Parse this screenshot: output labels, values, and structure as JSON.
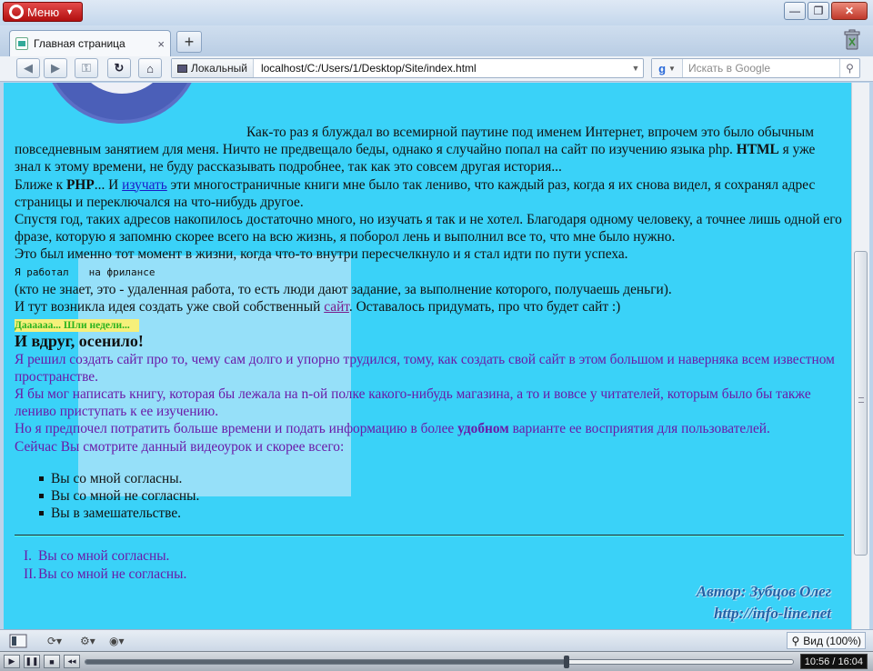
{
  "window": {
    "menu_label": "Меню",
    "controls": [
      "—",
      "❐",
      "✕"
    ]
  },
  "tab": {
    "title": "Главная страница",
    "close": "×",
    "new_tab": "+"
  },
  "navbar": {
    "back": "◀",
    "forward": "▶",
    "reload": "↻",
    "home": "⌂",
    "key": "⚿",
    "site_label": "Локальный",
    "url": "localhost/C:/Users/1/Desktop/Site/index.html",
    "search_placeholder": "Искать в Google",
    "search_engine": "g"
  },
  "page": {
    "para1": "Как-то раз я блуждал во всемирной паутине под именем Интернет, впрочем это было обычным повседневным занятием для меня. Ничто не предвещало беды, однако я случайно попал на сайт по изучению языка php.",
    "html_bold": "HTML",
    "para1_tail": "я уже знал к этому времени, не буду рассказывать подробнее, так как это совсем другая история...",
    "line2_a": "Ближе к",
    "php_bold": "PHP",
    "line2_b": "... И",
    "link_izuchat": "изучать",
    "line2_c": "эти многостраничные книги мне было так лениво, что каждый раз, когда я их снова видел, я сохранял адрес страницы и переключался на что-нибудь другое.",
    "line3": "Спустя год, таких адресов накопилось достаточно много, но изучать я так и не хотел. Благодаря одному человеку, а точнее лишь одной его фразе, которую я запомню скорее всего на всю жизнь, я поборол лень и выполнил все то, что мне было нужно.",
    "line4": "Это был именно тот момент в жизни, когда что-то внутри пересчелкнуло и я стал идти по пути успеха.",
    "pre_a": "Я работал",
    "pre_b": "на фрилансе",
    "line5": "(кто не знает, это - удаленная работа, то есть люди дают задание, за выполнение которого, получаешь деньги).",
    "line6_a": "И тут возникла идея создать уже свой собственный",
    "link_sait": "сайт",
    "line6_b": ". Оставалось придумать, про что будет сайт :)",
    "highlight": "Даааааа... Шли недели...",
    "heading": "И вдруг, осенило!",
    "purple1": "Я решил создать сайт про то, чему сам долго и упорно трудился, тому, как создать свой сайт в этом большом и наверняка всем известном пространстве.",
    "purple2": "Я бы мог написать книгу, которая бы лежала на n-ой полке какого-нибудь магазина, а то и вовсе у читателей, которым было бы также лениво приступать к ее изучению.",
    "purple3_a": "Но я предпочел потратить больше времени и подать информацию в более",
    "purple3_bold": "удобном",
    "purple3_b": "варианте ее восприятия для пользователей.",
    "purple4": "Сейчас Вы смотрите данный видеоурок и скорее всего:",
    "bullets": [
      "Вы со мной согласны.",
      "Вы со мной не согласны.",
      "Вы в замешательстве."
    ],
    "ordered": [
      {
        "num": "I.",
        "text": "Вы со мной согласны."
      },
      {
        "num": "II.",
        "text": "Вы со мной не согласны."
      }
    ]
  },
  "watermark": {
    "author": "Автор: Зубцов Олег",
    "site": "http://info-line.net"
  },
  "statusbar": {
    "zoom_label": "Вид (100%)"
  },
  "player": {
    "time": "10:56 / 16:04",
    "progress": 0.68
  }
}
